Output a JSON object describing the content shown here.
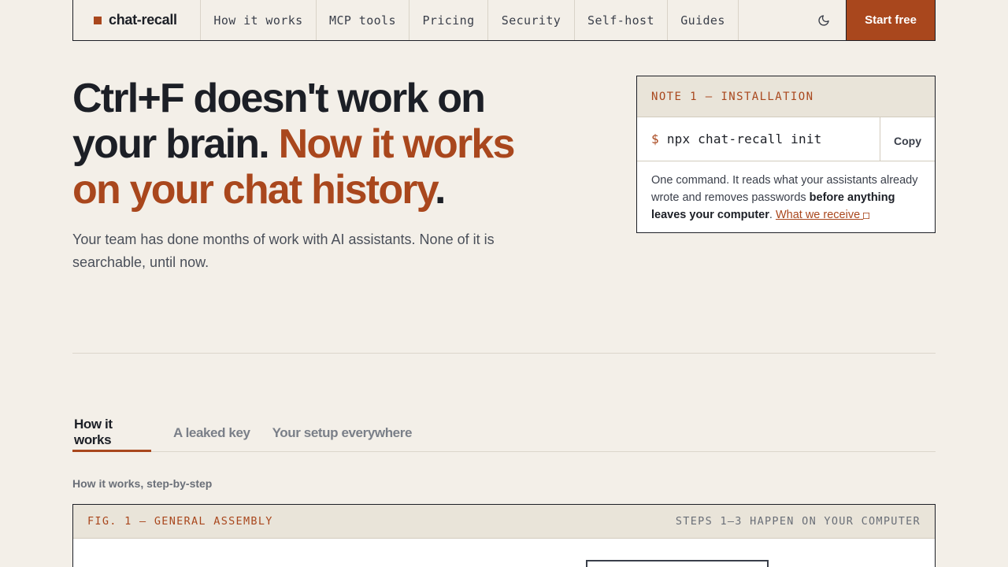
{
  "nav": {
    "brand": "chat-recall",
    "links": [
      "How it works",
      "MCP tools",
      "Pricing",
      "Security",
      "Self-host",
      "Guides"
    ],
    "theme_icon": "moon-icon",
    "cta": "Start free"
  },
  "hero": {
    "title_part1": "Ctrl+F doesn't work on your brain. ",
    "title_accent": "Now it works on your chat history",
    "title_end": ".",
    "subtitle": "Your team has done months of work with AI assistants. None of it is searchable, until now."
  },
  "note": {
    "heading": "NOTE 1 — INSTALLATION",
    "prompt": "$",
    "command": "npx chat-recall init",
    "copy_label": "Copy",
    "body_part1": "One command. It reads what your assistants already wrote and removes passwords ",
    "body_bold": "before anything leaves your computer",
    "body_part2": ". ",
    "link_label": "What we receive",
    "link_icon": "external-link-icon"
  },
  "tabs": {
    "items": [
      "How it works",
      "A leaked key",
      "Your setup everywhere"
    ],
    "active_index": 0
  },
  "section": {
    "label": "How it works, step-by-step"
  },
  "figure": {
    "title": "FIG. 1 — GENERAL ASSEMBLY",
    "note": "STEPS 1–3 HAPPEN ON YOUR COMPUTER"
  },
  "colors": {
    "accent": "#a9471d",
    "background": "#f3efe8",
    "text": "#1c1f26"
  }
}
